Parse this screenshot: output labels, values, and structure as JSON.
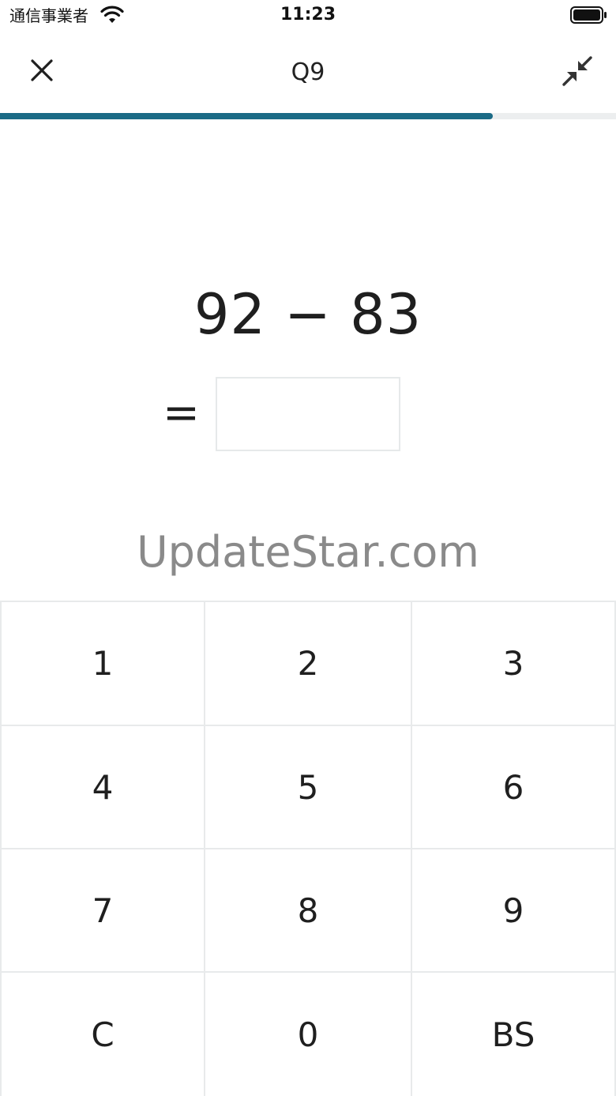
{
  "status_bar": {
    "carrier": "通信事業者",
    "time": "11:23",
    "wifi_icon": "wifi-icon",
    "battery_icon": "battery-icon"
  },
  "header": {
    "title": "Q9",
    "close_icon": "close-icon",
    "minimize_icon": "minimize-icon"
  },
  "progress": {
    "percent": 80,
    "fill_color": "#1b6b86",
    "track_color": "#eceeef"
  },
  "question": {
    "expression": "92 − 83",
    "equals": "=",
    "answer": ""
  },
  "watermark": "UpdateStar.com",
  "keypad": {
    "keys": [
      {
        "label": "1",
        "name": "key-1"
      },
      {
        "label": "2",
        "name": "key-2"
      },
      {
        "label": "3",
        "name": "key-3"
      },
      {
        "label": "4",
        "name": "key-4"
      },
      {
        "label": "5",
        "name": "key-5"
      },
      {
        "label": "6",
        "name": "key-6"
      },
      {
        "label": "7",
        "name": "key-7"
      },
      {
        "label": "8",
        "name": "key-8"
      },
      {
        "label": "9",
        "name": "key-9"
      },
      {
        "label": "C",
        "name": "key-clear"
      },
      {
        "label": "0",
        "name": "key-0"
      },
      {
        "label": "BS",
        "name": "key-backspace"
      }
    ]
  }
}
